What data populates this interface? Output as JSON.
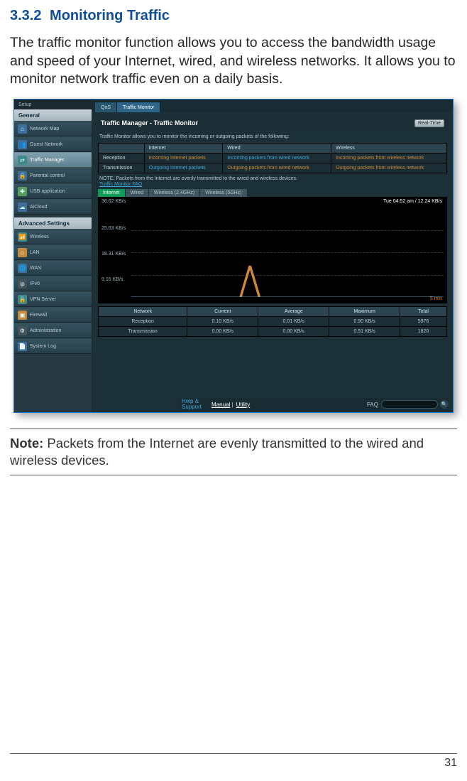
{
  "heading": {
    "number": "3.3.2",
    "title": "Monitoring Traffic"
  },
  "paragraph": "The traffic monitor function allows you to access the bandwidth usage and speed of your Internet, wired, and wireless networks. It allows you to monitor network traffic even on a daily basis.",
  "note": {
    "label": "Note:",
    "text": "  Packets from the Internet are evenly transmitted to the wired and wireless devices."
  },
  "page_number": "31",
  "sidebar": {
    "setup": "Setup",
    "general": "General",
    "items_general": [
      {
        "icon": "⌂",
        "label": "Network Map",
        "cls": "blue"
      },
      {
        "icon": "👥",
        "label": "Guest Network",
        "cls": "blue"
      },
      {
        "icon": "⇄",
        "label": "Traffic Manager",
        "cls": "teal",
        "active": true
      },
      {
        "icon": "🔒",
        "label": "Parental control",
        "cls": "blue"
      },
      {
        "icon": "✚",
        "label": "USB application",
        "cls": "green"
      },
      {
        "icon": "☁",
        "label": "AiCloud",
        "cls": "blue"
      }
    ],
    "advanced": "Advanced Settings",
    "items_advanced": [
      {
        "icon": "📶",
        "label": "Wireless",
        "cls": "teal"
      },
      {
        "icon": "⌂",
        "label": "LAN",
        "cls": "orange"
      },
      {
        "icon": "🌐",
        "label": "WAN",
        "cls": "blue"
      },
      {
        "icon": "ip",
        "label": "IPv6",
        "cls": "grey"
      },
      {
        "icon": "🔒",
        "label": "VPN Server",
        "cls": "teal"
      },
      {
        "icon": "▣",
        "label": "Firewall",
        "cls": "orange"
      },
      {
        "icon": "⚙",
        "label": "Administration",
        "cls": "grey"
      },
      {
        "icon": "📄",
        "label": "System Log",
        "cls": "blue"
      }
    ]
  },
  "panel": {
    "top_tabs": [
      {
        "label": "QoS",
        "active": false
      },
      {
        "label": "Traffic Monitor",
        "active": true
      }
    ],
    "title": "Traffic Manager - Traffic Monitor",
    "rt_btn": "Real-Time",
    "desc": "Traffic Monitor allows you to monitor the incoming or outgoing packets of the following:",
    "net_table": {
      "headers": [
        "",
        "Internet",
        "Wired",
        "Wireless"
      ],
      "rows": [
        {
          "h": "Reception",
          "c": [
            "Incoming Internet packets",
            "Incoming packets from wired network",
            "Incoming packets from wireless network"
          ]
        },
        {
          "h": "Transmission",
          "c": [
            "Outgoing Internet packets",
            "Outgoing packets from wired network",
            "Outgoing packets from wireless network"
          ]
        }
      ]
    },
    "note": "NOTE: Packets from the Internet are evenly transmitted to the wired and wireless devices.",
    "faq_link": "Traffic Monitor FAQ",
    "sub_tabs": [
      "Internet",
      "Wired",
      "Wireless (2.4GHz)",
      "Wireless (5GHz)"
    ],
    "chart": {
      "top_right": "Tue 04:52 am / 12.24 KB/s",
      "y_labels": [
        "36.62 KB/s",
        "25.63 KB/s",
        "18.31 KB/s",
        "9.16 KB/s"
      ],
      "legend": "5 min"
    },
    "stats": {
      "headers": [
        "Network",
        "Current",
        "Average",
        "Maximum",
        "Total"
      ],
      "rows": [
        {
          "label": "Reception",
          "vals": [
            "0.10 KB/s",
            "0.01 KB/s",
            "0.90 KB/s",
            "5976"
          ]
        },
        {
          "label": "Transmission",
          "vals": [
            "0.00 KB/s",
            "0.00 KB/s",
            "0.51 KB/s",
            "1820"
          ]
        }
      ]
    },
    "help": {
      "left": "Help &\nSupport",
      "manual": "Manual",
      "utility": "Utility",
      "faq": "FAQ"
    }
  },
  "chart_data": {
    "type": "line",
    "title": "Internet traffic",
    "ylabel": "KB/s",
    "ylim": [
      0,
      36.62
    ],
    "y_ticks": [
      9.16,
      18.31,
      25.63,
      36.62
    ],
    "timestamp": "Tue 04:52 am",
    "current_kb_s": 12.24,
    "x_window_minutes": 5,
    "series": [
      {
        "name": "Reception",
        "color": "#d08a35",
        "values": [
          0,
          0,
          0,
          0,
          12,
          0,
          0,
          0,
          0,
          0,
          0,
          0
        ]
      },
      {
        "name": "Transmission",
        "color": "#3ea5d6",
        "values": [
          0,
          0,
          0,
          0,
          0,
          0,
          0,
          0,
          0,
          0,
          0,
          0
        ]
      }
    ]
  }
}
